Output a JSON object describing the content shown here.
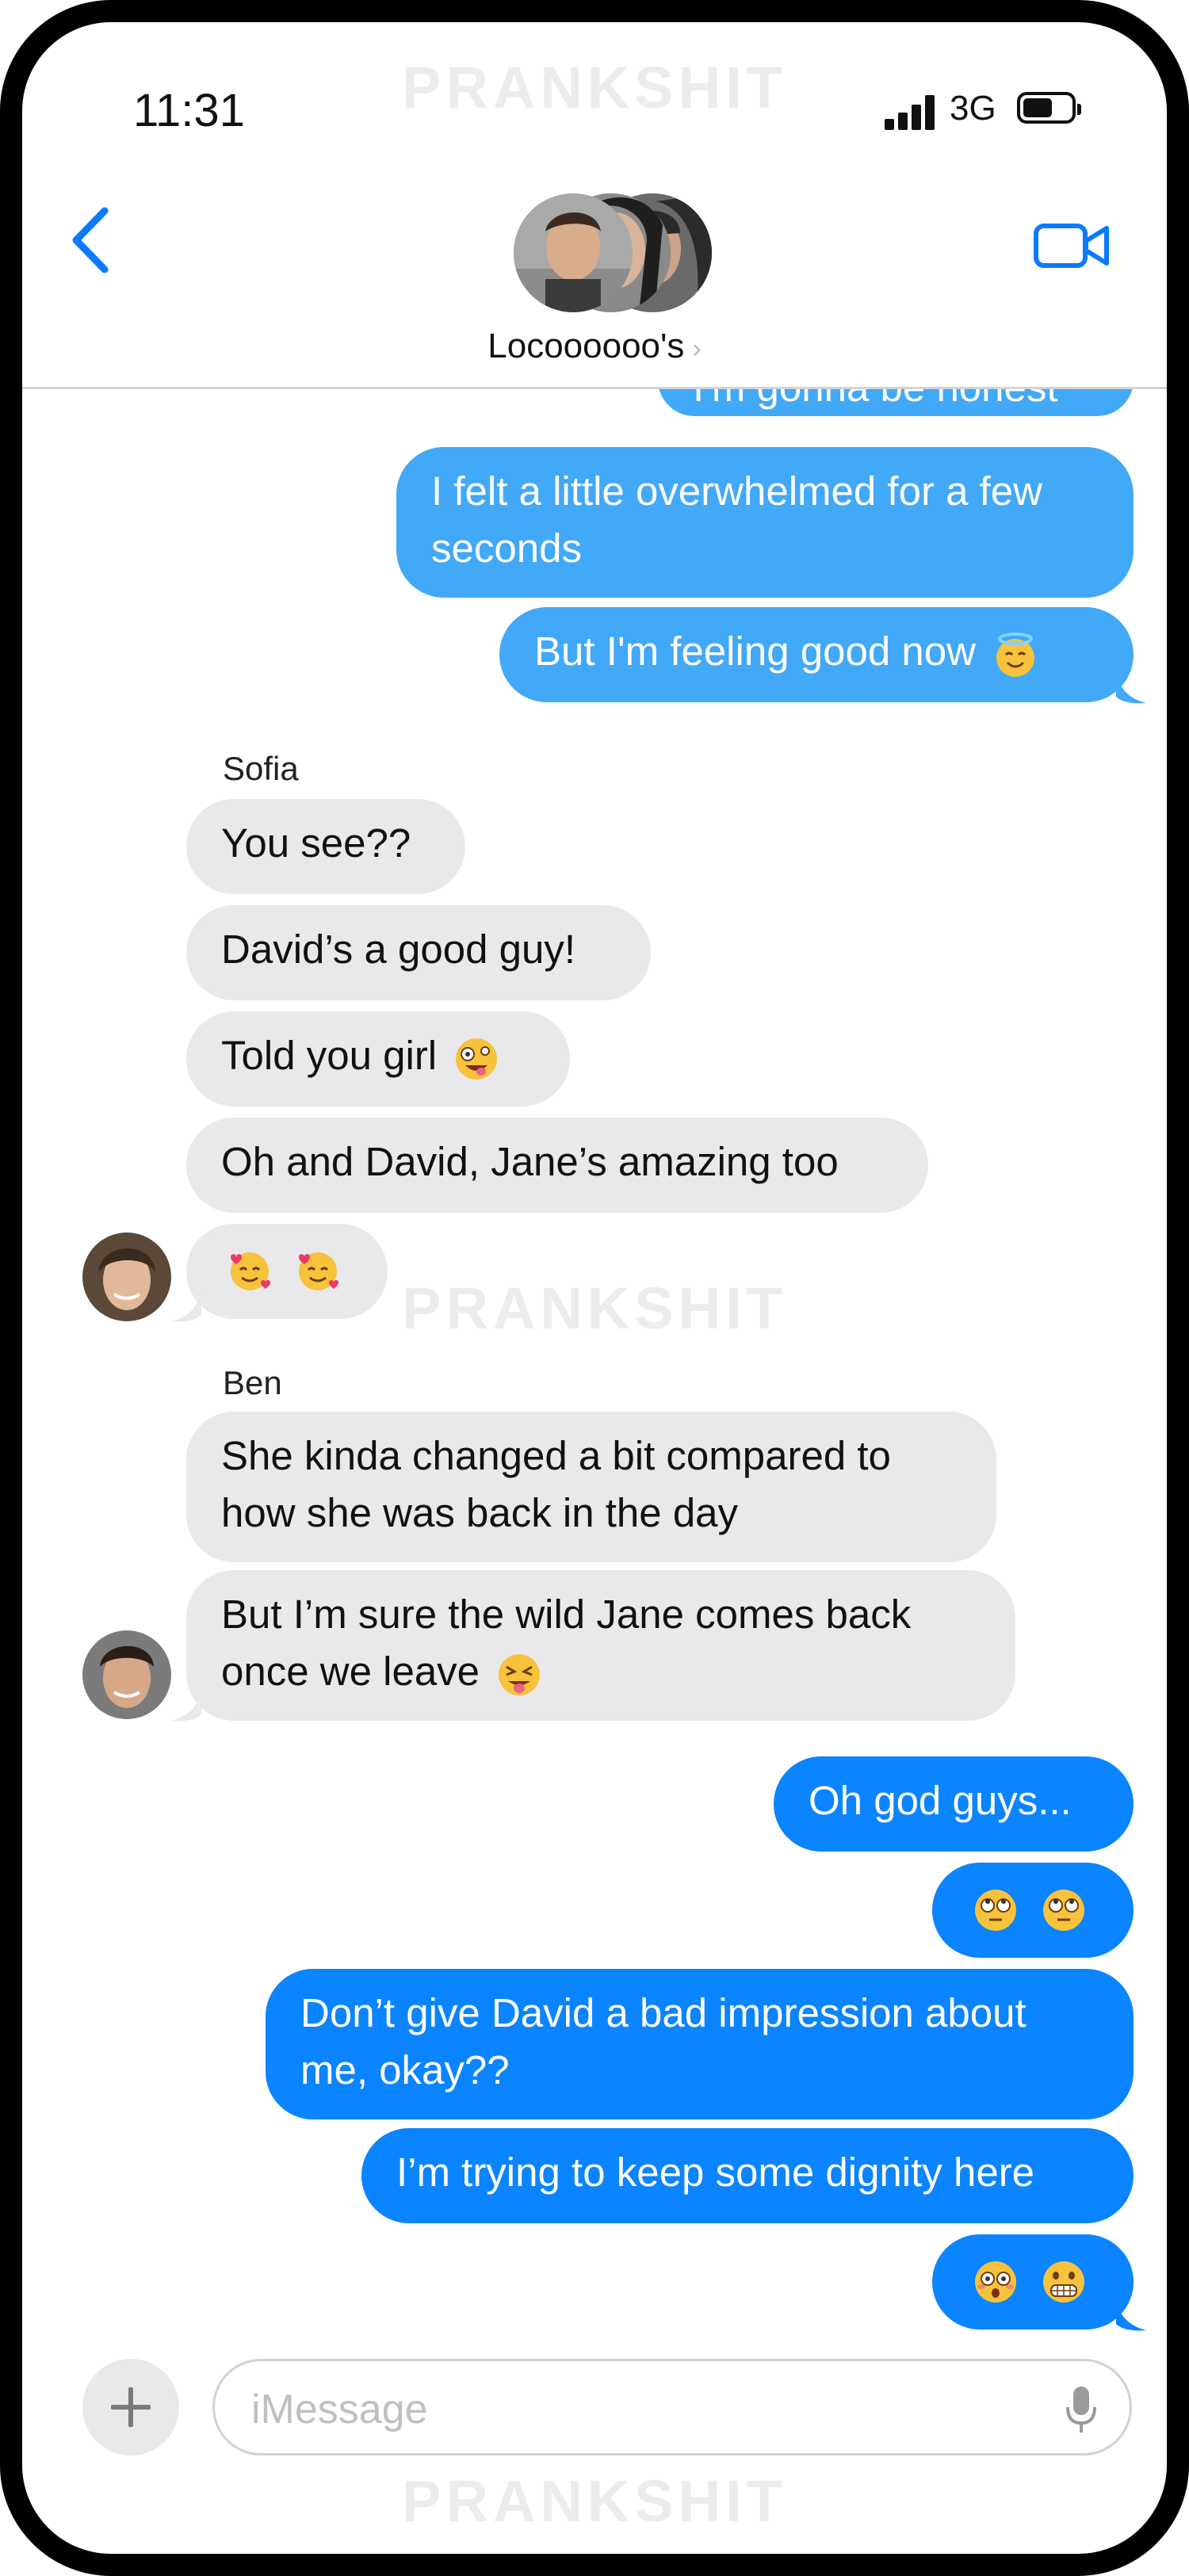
{
  "watermark": "PRANKSHIT",
  "status": {
    "time": "11:31",
    "network": "3G"
  },
  "header": {
    "group_name": "Locoooooo's",
    "chevron": "›"
  },
  "messages": {
    "m0": "I'm gonna be honest",
    "m1_line1": "I felt a little overwhelmed for a few",
    "m1_line2": "seconds",
    "m2": "But I'm feeling good now",
    "sofia_name": "Sofia",
    "m3": "You see??",
    "m4": "David’s a good guy!",
    "m5": "Told you girl",
    "m6": "Oh and David, Jane’s amazing too",
    "ben_name": "Ben",
    "m8_line1": "She kinda changed a bit compared to",
    "m8_line2": "how she was back in the day",
    "m9_line1": "But I’m sure the wild Jane comes back",
    "m9_line2": "once we leave",
    "m10": "Oh god guys...",
    "m12_line1": "Don’t give David a bad impression about",
    "m12_line2": "me, okay??",
    "m13": "I’m trying to keep some dignity here"
  },
  "composer": {
    "placeholder": "iMessage"
  },
  "icons": {
    "back": "back-chevron-icon",
    "video": "video-camera-icon",
    "plus": "plus-icon",
    "mic": "microphone-icon"
  },
  "colors": {
    "outgoing": "#0a84ff",
    "outgoing_light": "#42a8f8",
    "incoming": "#e9e9eb",
    "accent": "#0a7aff"
  }
}
